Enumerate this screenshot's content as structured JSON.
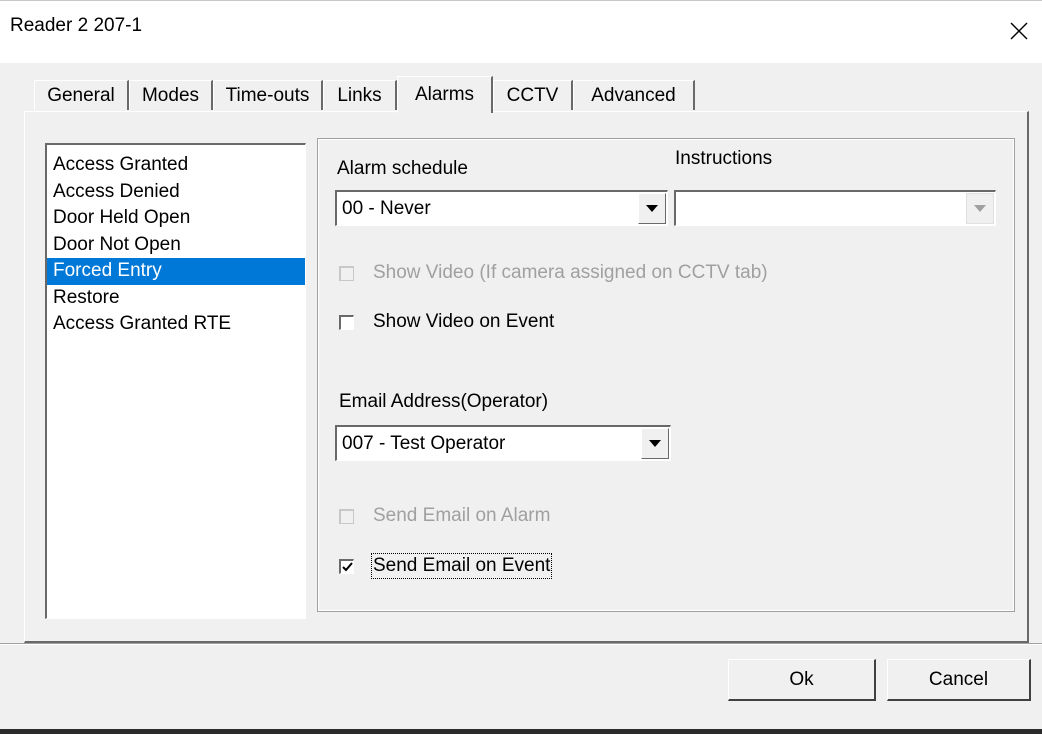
{
  "window": {
    "title": "Reader 2 207-1"
  },
  "tabs": [
    {
      "label": "General"
    },
    {
      "label": "Modes"
    },
    {
      "label": "Time-outs"
    },
    {
      "label": "Links"
    },
    {
      "label": "Alarms",
      "active": true
    },
    {
      "label": "CCTV"
    },
    {
      "label": "Advanced"
    }
  ],
  "events": {
    "items": [
      "Access Granted",
      "Access Denied",
      "Door Held Open",
      "Door Not Open",
      "Forced Entry",
      "Restore",
      "Access Granted RTE"
    ],
    "selected": "Forced Entry"
  },
  "alarm": {
    "schedule_label": "Alarm schedule",
    "schedule_value": "00 - Never",
    "instructions_label": "Instructions",
    "instructions_value": "",
    "show_video_cctv": {
      "label": "Show Video (If camera assigned on CCTV tab)",
      "checked": false,
      "enabled": false
    },
    "show_video_event": {
      "label": "Show Video on Event",
      "checked": false,
      "enabled": true
    },
    "email_label": "Email Address(Operator)",
    "email_value": "007 - Test Operator",
    "send_email_alarm": {
      "label": "Send Email on Alarm",
      "checked": false,
      "enabled": false
    },
    "send_email_event": {
      "label": "Send Email on Event",
      "checked": true,
      "enabled": true
    }
  },
  "buttons": {
    "ok": "Ok",
    "cancel": "Cancel"
  },
  "icons": {
    "close": "close-icon",
    "dropdown": "chevron-down-icon",
    "check": "checkmark-icon"
  },
  "colors": {
    "selection": "#0078d7",
    "face": "#f0f0f0",
    "disabled_text": "#a0a0a0"
  }
}
